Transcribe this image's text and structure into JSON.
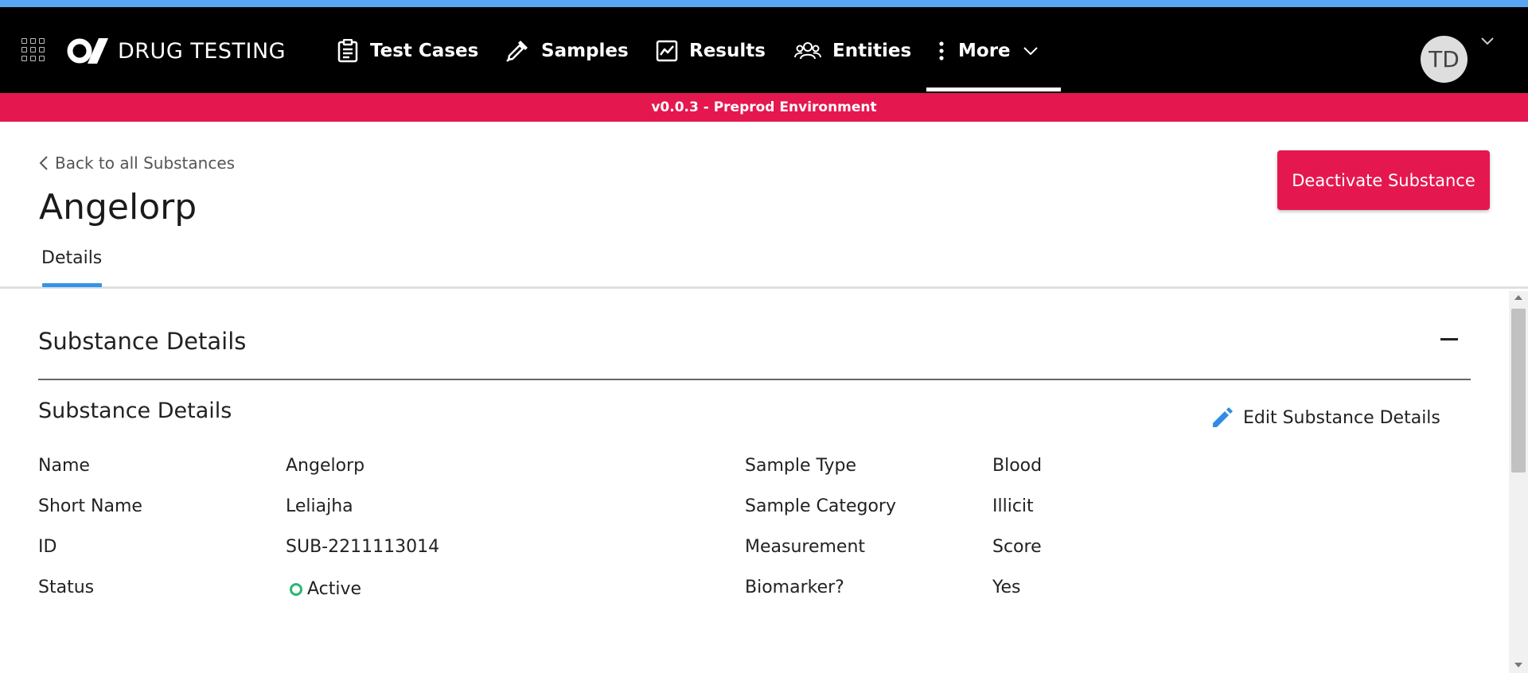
{
  "app": {
    "brand_name": "DRUG TESTING",
    "env_banner": "v0.0.3 - Preprod Environment"
  },
  "nav": {
    "items": [
      {
        "label": "Test Cases",
        "icon": "clipboard-icon"
      },
      {
        "label": "Samples",
        "icon": "dropper-icon"
      },
      {
        "label": "Results",
        "icon": "chart-icon"
      },
      {
        "label": "Entities",
        "icon": "users-icon"
      },
      {
        "label": "More",
        "icon": "more-vertical-icon"
      }
    ],
    "active": "More",
    "avatar_initials": "TD"
  },
  "header": {
    "back_link": "Back to all Substances",
    "title": "Angelorp",
    "deactivate_button": "Deactivate Substance",
    "tabs": [
      {
        "label": "Details",
        "active": true
      }
    ]
  },
  "section": {
    "title": "Substance Details",
    "subtitle": "Substance Details",
    "edit_link": "Edit Substance Details",
    "fields_left": [
      {
        "label": "Name",
        "value": "Angelorp"
      },
      {
        "label": "Short Name",
        "value": "Leliajha"
      },
      {
        "label": "ID",
        "value": "SUB-2211113014"
      },
      {
        "label": "Status",
        "value": "Active"
      }
    ],
    "fields_right": [
      {
        "label": "Sample Type",
        "value": "Blood"
      },
      {
        "label": "Sample Category",
        "value": "Illicit"
      },
      {
        "label": "Measurement",
        "value": "Score"
      },
      {
        "label": "Biomarker?",
        "value": "Yes"
      }
    ]
  },
  "colors": {
    "accent_blue": "#58a6f3",
    "brand_red": "#e4184f",
    "status_green": "#2bb673",
    "tab_blue": "#3592ea"
  }
}
